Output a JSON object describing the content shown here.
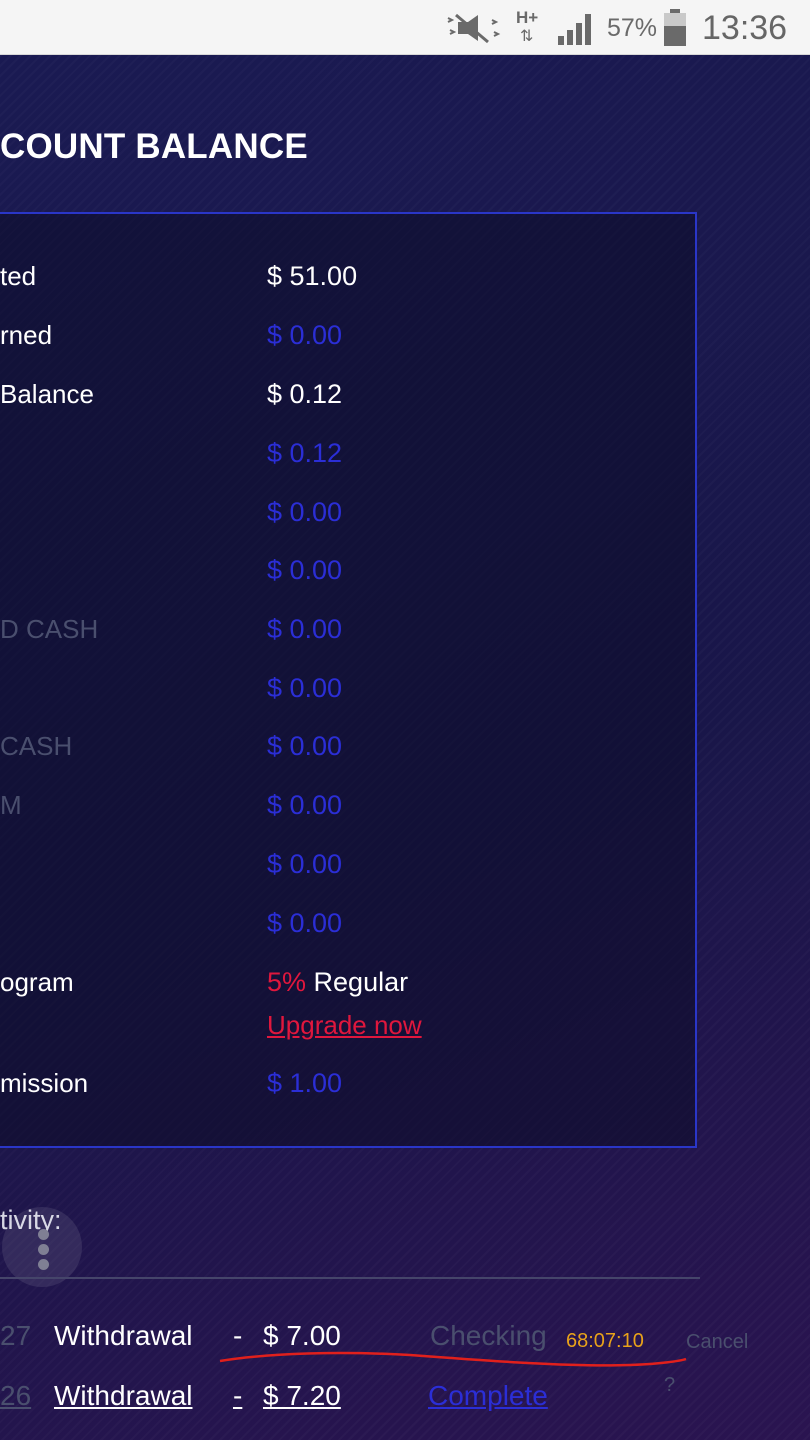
{
  "status_bar": {
    "battery_percent": "57%",
    "time": "13:36",
    "network_type": "H+",
    "icons": [
      "mute-vibrate-icon",
      "network-data-icon",
      "signal-strength-icon",
      "battery-icon"
    ]
  },
  "page": {
    "title": "COUNT BALANCE"
  },
  "balance_rows": [
    {
      "label": "ted",
      "value": "$ 51.00"
    },
    {
      "label": "rned",
      "value": "$ 0.00"
    },
    {
      "label": "Balance",
      "value": "$ 0.12"
    },
    {
      "label": "",
      "value": "$ 0.12"
    },
    {
      "label": "",
      "value": "$ 0.00"
    },
    {
      "label": "",
      "value": "$ 0.00"
    },
    {
      "label": "D CASH",
      "value": "$ 0.00"
    },
    {
      "label": "",
      "value": "$ 0.00"
    },
    {
      "label": "CASH",
      "value": "$ 0.00"
    },
    {
      "label": "M",
      "value": "$ 0.00"
    },
    {
      "label": "",
      "value": "$ 0.00"
    },
    {
      "label": "",
      "value": "$ 0.00"
    }
  ],
  "program": {
    "label": "ogram",
    "percent": "5%",
    "tier": "Regular",
    "upgrade_link": "Upgrade now"
  },
  "commission": {
    "label": "mission",
    "value": "$ 1.00"
  },
  "activity": {
    "label": "tivity:",
    "rows": [
      {
        "date": "27",
        "type": "Withdrawal",
        "sep": "-",
        "amount": "$ 7.00",
        "status": "Checking",
        "timer": "68:07:10",
        "action": "Cancel"
      },
      {
        "date": "26",
        "type": "Withdrawal",
        "sep": "-",
        "amount": "$ 7.20",
        "status": "Complete",
        "help": "?"
      }
    ]
  },
  "colors": {
    "accent_blue": "#2b2ed6",
    "accent_red": "#e0173d",
    "timer_orange": "#e8a21a",
    "annotation_red": "#e0201c"
  }
}
